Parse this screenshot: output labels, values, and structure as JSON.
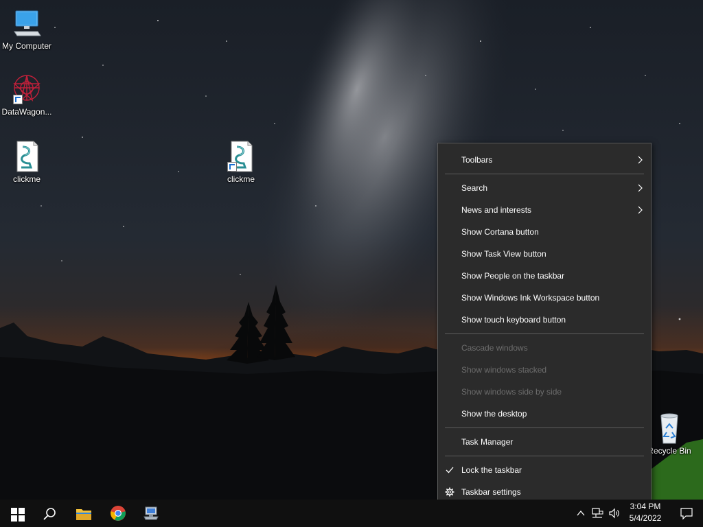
{
  "desktop": {
    "icons": [
      {
        "label": "My Computer"
      },
      {
        "label": "DataWagon..."
      },
      {
        "label": "clickme"
      },
      {
        "label": "clickme"
      },
      {
        "label": "Recycle Bin"
      }
    ]
  },
  "context_menu": {
    "items": [
      {
        "label": "Toolbars",
        "submenu": true
      },
      {
        "label": "Search",
        "submenu": true
      },
      {
        "label": "News and interests",
        "submenu": true
      },
      {
        "label": "Show Cortana button"
      },
      {
        "label": "Show Task View button"
      },
      {
        "label": "Show People on the taskbar"
      },
      {
        "label": "Show Windows Ink Workspace button"
      },
      {
        "label": "Show touch keyboard button"
      },
      {
        "label": "Cascade windows",
        "disabled": true
      },
      {
        "label": "Show windows stacked",
        "disabled": true
      },
      {
        "label": "Show windows side by side",
        "disabled": true
      },
      {
        "label": "Show the desktop"
      },
      {
        "label": "Task Manager"
      },
      {
        "label": "Lock the taskbar",
        "checked": true
      },
      {
        "label": "Taskbar settings",
        "icon": "gear-icon"
      }
    ]
  },
  "taskbar": {
    "buttons": [
      "start-icon",
      "search-icon",
      "file-explorer-icon",
      "chrome-icon",
      "network-app-icon"
    ],
    "tray": {
      "time": "3:04 PM",
      "date": "5/4/2022"
    }
  },
  "colors": {
    "menu_bg": "#2b2b2b",
    "menu_text": "#ffffff",
    "menu_disabled": "#6d6d6d",
    "taskbar_bg": "#101010"
  }
}
